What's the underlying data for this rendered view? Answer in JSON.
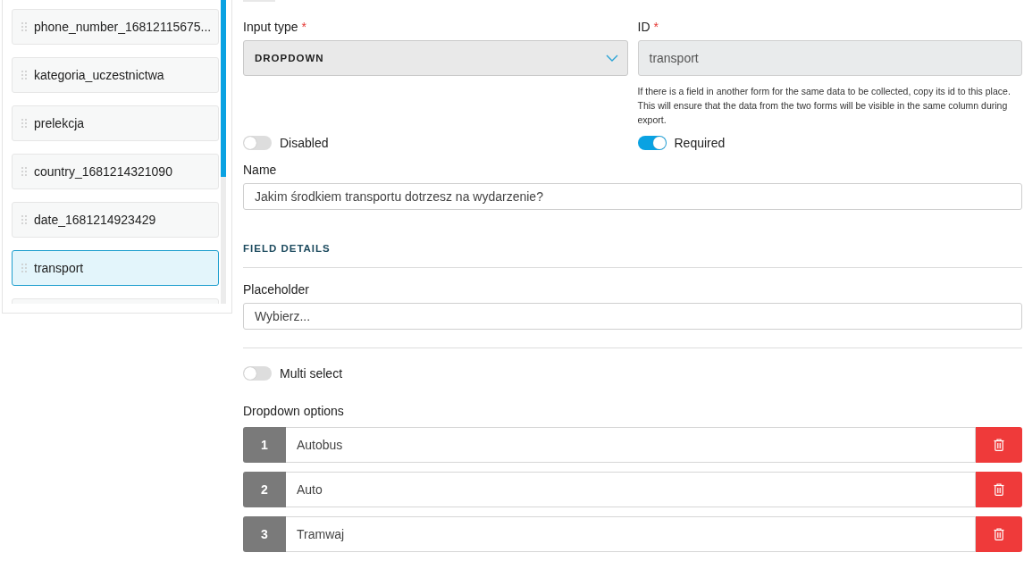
{
  "sidebar": {
    "items": [
      {
        "label": "phone_number_16812115675...",
        "selected": false
      },
      {
        "label": "kategoria_uczestnictwa",
        "selected": false
      },
      {
        "label": "prelekcja",
        "selected": false
      },
      {
        "label": "country_1681214321090",
        "selected": false
      },
      {
        "label": "date_1681214923429",
        "selected": false
      },
      {
        "label": "transport",
        "selected": true
      }
    ]
  },
  "form": {
    "input_type": {
      "label": "Input type",
      "required_mark": "*",
      "value": "DROPDOWN"
    },
    "id": {
      "label": "ID",
      "required_mark": "*",
      "value": "transport",
      "help": "If there is a field in another form for the same data to be collected, copy its id to this place. This will ensure that the data from the two forms will be visible in the same column during export."
    },
    "toggles": [
      {
        "label": "Disabled",
        "on": false
      },
      {
        "label": "Required",
        "on": true
      }
    ],
    "name": {
      "label": "Name",
      "value": "Jakim środkiem transportu dotrzesz na wydarzenie?"
    },
    "section_title": "FIELD DETAILS",
    "placeholder_field": {
      "label": "Placeholder",
      "value": "Wybierz..."
    },
    "multi_select": {
      "label": "Multi select",
      "on": false
    },
    "options_label": "Dropdown options",
    "options": [
      {
        "number": "1",
        "value": "Autobus"
      },
      {
        "number": "2",
        "value": "Auto"
      },
      {
        "number": "3",
        "value": "Tramwaj"
      }
    ]
  }
}
